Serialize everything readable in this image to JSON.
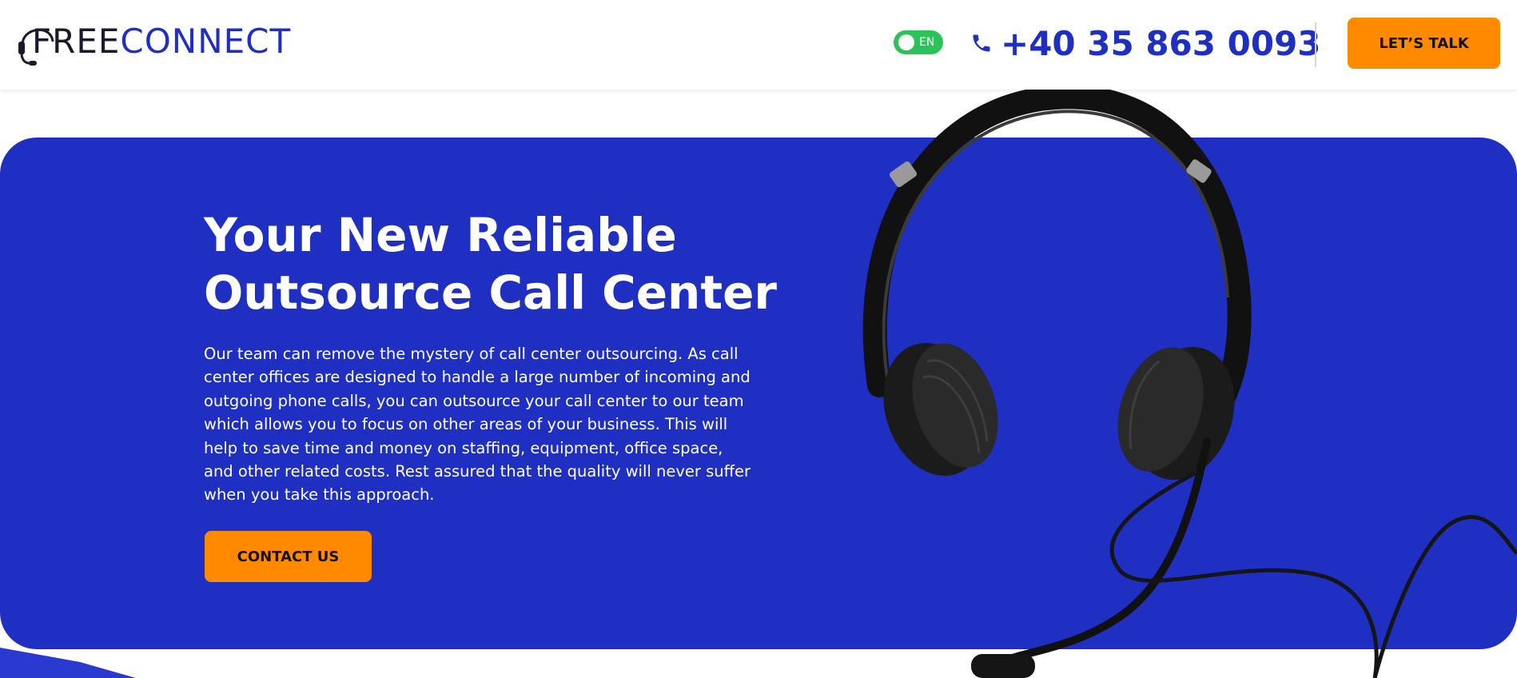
{
  "header": {
    "logo": {
      "part1": "FREE",
      "part2": "CONNECT"
    },
    "language": "EN",
    "phone": "+40 35 863 0093",
    "cta_label": "LET’S TALK"
  },
  "hero": {
    "title": "Your New Reliable\nOutsource Call Center",
    "description": "Our team can remove the mystery of call center outsourcing. As call center offices are designed to handle a large number of incoming and outgoing phone calls, you can outsource your call center to our team which allows you to focus on other areas of your business. This will help to save time and money on staffing, equipment, office space, and other related costs. Rest assured that the quality will never suffer when you take this approach.",
    "button_label": "CONTACT US"
  },
  "colors": {
    "brand_blue": "#1f2fc2",
    "accent_orange": "#ff8a00",
    "toggle_green": "#2bc25a"
  },
  "icons": [
    "headset-logo-icon",
    "phone-icon",
    "headset-image"
  ]
}
